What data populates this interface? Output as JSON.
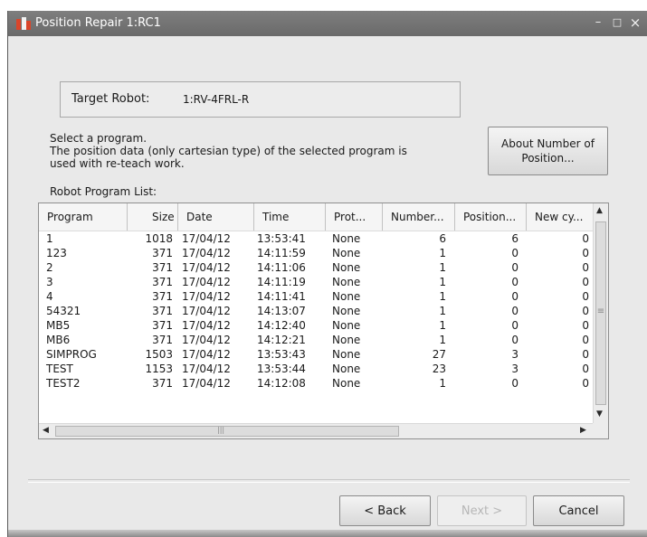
{
  "window": {
    "title": "Position Repair 1:RC1",
    "minimize": "–",
    "maximize": "□",
    "close": "×"
  },
  "target": {
    "label": "Target Robot:",
    "value": "1:RV-4FRL-R"
  },
  "description": [
    "Select a program.",
    "The position data (only cartesian type) of the selected program is",
    "used with re-teach work."
  ],
  "about_button": [
    "About Number of",
    "Position..."
  ],
  "list_label": "Robot Program List:",
  "table": {
    "columns": [
      "Program",
      "Size",
      "Date",
      "Time",
      "Prot...",
      "Number...",
      "Position...",
      "New cy..."
    ],
    "rows": [
      [
        "1",
        "1018",
        "17/04/12",
        "13:53:41",
        "None",
        "6",
        "6",
        "0"
      ],
      [
        "123",
        "371",
        "17/04/12",
        "14:11:59",
        "None",
        "1",
        "0",
        "0"
      ],
      [
        "2",
        "371",
        "17/04/12",
        "14:11:06",
        "None",
        "1",
        "0",
        "0"
      ],
      [
        "3",
        "371",
        "17/04/12",
        "14:11:19",
        "None",
        "1",
        "0",
        "0"
      ],
      [
        "4",
        "371",
        "17/04/12",
        "14:11:41",
        "None",
        "1",
        "0",
        "0"
      ],
      [
        "54321",
        "371",
        "17/04/12",
        "14:13:07",
        "None",
        "1",
        "0",
        "0"
      ],
      [
        "MB5",
        "371",
        "17/04/12",
        "14:12:40",
        "None",
        "1",
        "0",
        "0"
      ],
      [
        "MB6",
        "371",
        "17/04/12",
        "14:12:21",
        "None",
        "1",
        "0",
        "0"
      ],
      [
        "SIMPROG",
        "1503",
        "17/04/12",
        "13:53:43",
        "None",
        "27",
        "3",
        "0"
      ],
      [
        "TEST",
        "1153",
        "17/04/12",
        "13:53:44",
        "None",
        "23",
        "3",
        "0"
      ],
      [
        "TEST2",
        "371",
        "17/04/12",
        "14:12:08",
        "None",
        "1",
        "0",
        "0"
      ]
    ]
  },
  "scrollbar": {
    "up": "▲",
    "down": "▼",
    "left": "◀",
    "right": "▶",
    "grip_v": "≡",
    "grip_h": "|||"
  },
  "buttons": {
    "back": "< Back",
    "next": "Next >",
    "cancel": "Cancel"
  },
  "colors": {
    "titlebar": "#6f6f6f",
    "dialog_bg": "#e9e9e9",
    "disabled_text": "#b6b6b6"
  }
}
